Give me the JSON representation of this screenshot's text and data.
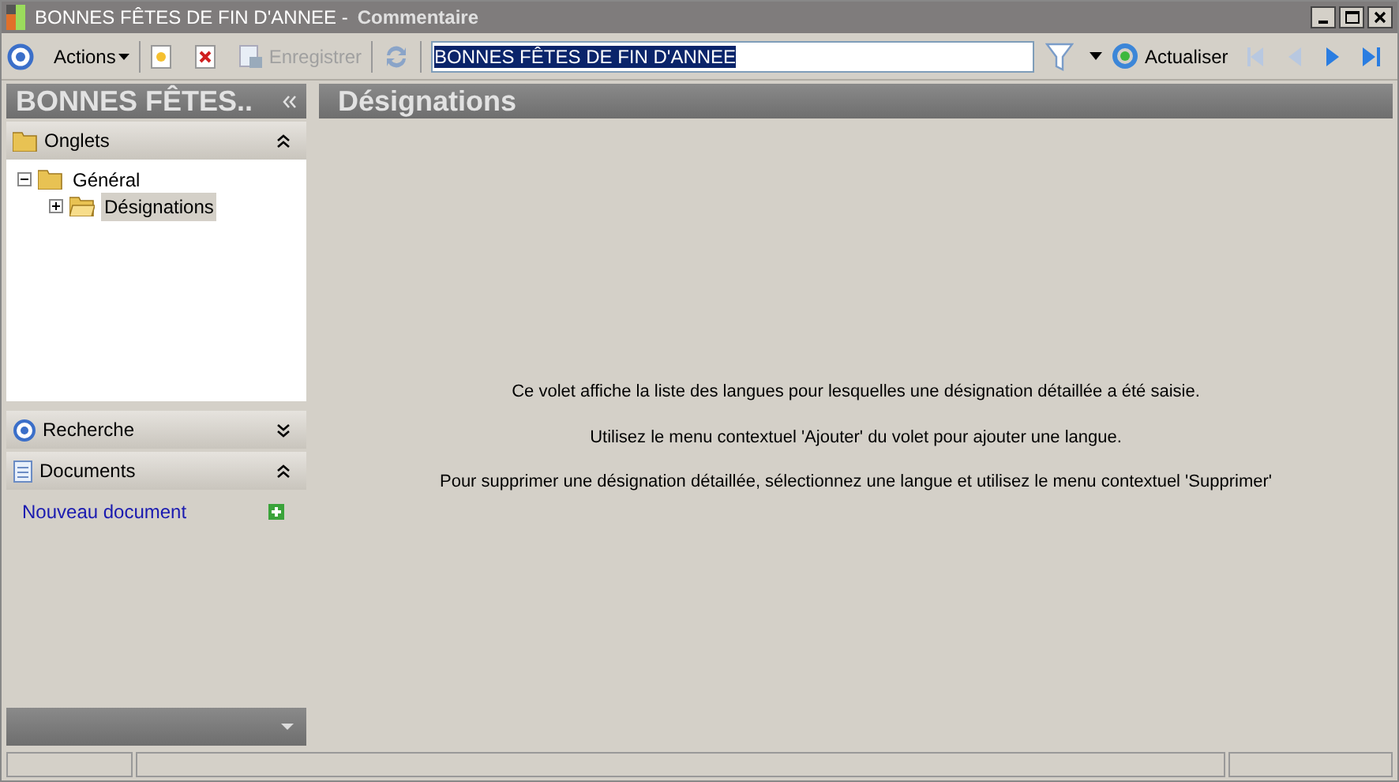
{
  "window": {
    "title": "BONNES FÊTES DE FIN D'ANNEE -",
    "subtitle": "Commentaire"
  },
  "toolbar": {
    "actions": "Actions",
    "save": {
      "label": "Enregistrer",
      "disabled": true
    },
    "search_value": "BONNES FÊTES DE FIN D'ANNEE",
    "refresh": "Actualiser",
    "nav": [
      {
        "kind": "first",
        "disabled": true
      },
      {
        "kind": "prev",
        "disabled": true
      },
      {
        "kind": "next",
        "disabled": false
      },
      {
        "kind": "last",
        "disabled": false
      }
    ]
  },
  "sidebar": {
    "title": "BONNES FÊTES..",
    "sections": [
      {
        "kind": "tabs",
        "label": "Onglets",
        "expanded": true,
        "tree": [
          {
            "label": "Général",
            "expanded": true,
            "selected": false,
            "children": [
              {
                "label": "Désignations",
                "expanded": false,
                "selected": true
              }
            ]
          }
        ]
      },
      {
        "kind": "search",
        "label": "Recherche",
        "expanded": false
      },
      {
        "kind": "documents",
        "label": "Documents",
        "expanded": true,
        "links": [
          "Nouveau document"
        ]
      }
    ]
  },
  "panel": {
    "title": "Désignations",
    "messages": [
      "Ce volet affiche la liste des langues pour lesquelles une désignation détaillée a été saisie.",
      "Utilisez le menu contextuel 'Ajouter' du volet pour ajouter une langue.",
      "Pour supprimer une désignation détaillée, sélectionnez une langue et utilisez le menu contextuel 'Supprimer'"
    ]
  }
}
